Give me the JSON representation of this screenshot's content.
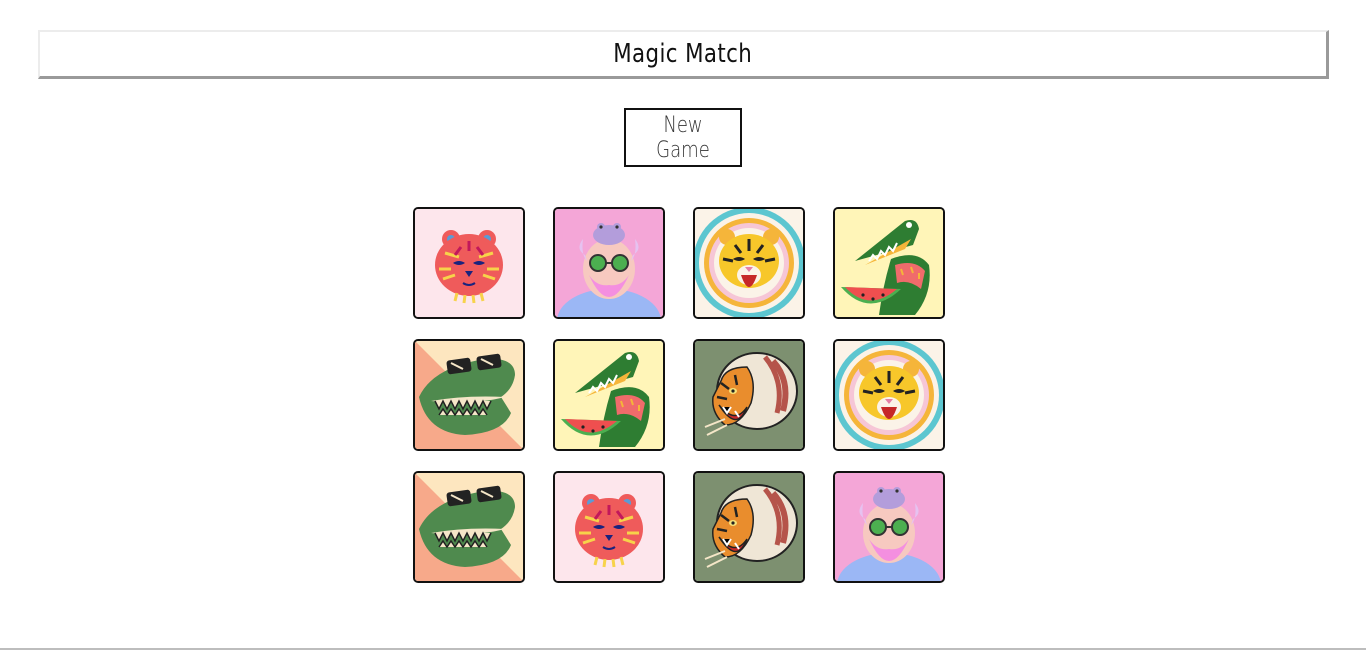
{
  "header": {
    "title": "Magic Match"
  },
  "controls": {
    "new_game_label": "New Game"
  },
  "board": {
    "rows": 3,
    "cols": 4,
    "cards": [
      {
        "image": "pink-tiger-face",
        "face_up": true
      },
      {
        "image": "old-man-with-frog",
        "face_up": true
      },
      {
        "image": "rainbow-tiger",
        "face_up": true
      },
      {
        "image": "crocodile-eating-watermelon",
        "face_up": true
      },
      {
        "image": "crocodile-with-sunglasses",
        "face_up": true
      },
      {
        "image": "crocodile-eating-watermelon",
        "face_up": true
      },
      {
        "image": "tiger-with-helmet",
        "face_up": true
      },
      {
        "image": "rainbow-tiger",
        "face_up": true
      },
      {
        "image": "crocodile-with-sunglasses",
        "face_up": true
      },
      {
        "image": "pink-tiger-face",
        "face_up": true
      },
      {
        "image": "tiger-with-helmet",
        "face_up": true
      },
      {
        "image": "old-man-with-frog",
        "face_up": true
      }
    ]
  },
  "colors": {
    "card_border": "#111111",
    "pink_bg": "#fde6ec",
    "violet_bg": "#f4a6d7",
    "yellow_bg": "#fff5b8",
    "peach_bg": "#f7a98a",
    "sage_bg": "#7d9070"
  }
}
